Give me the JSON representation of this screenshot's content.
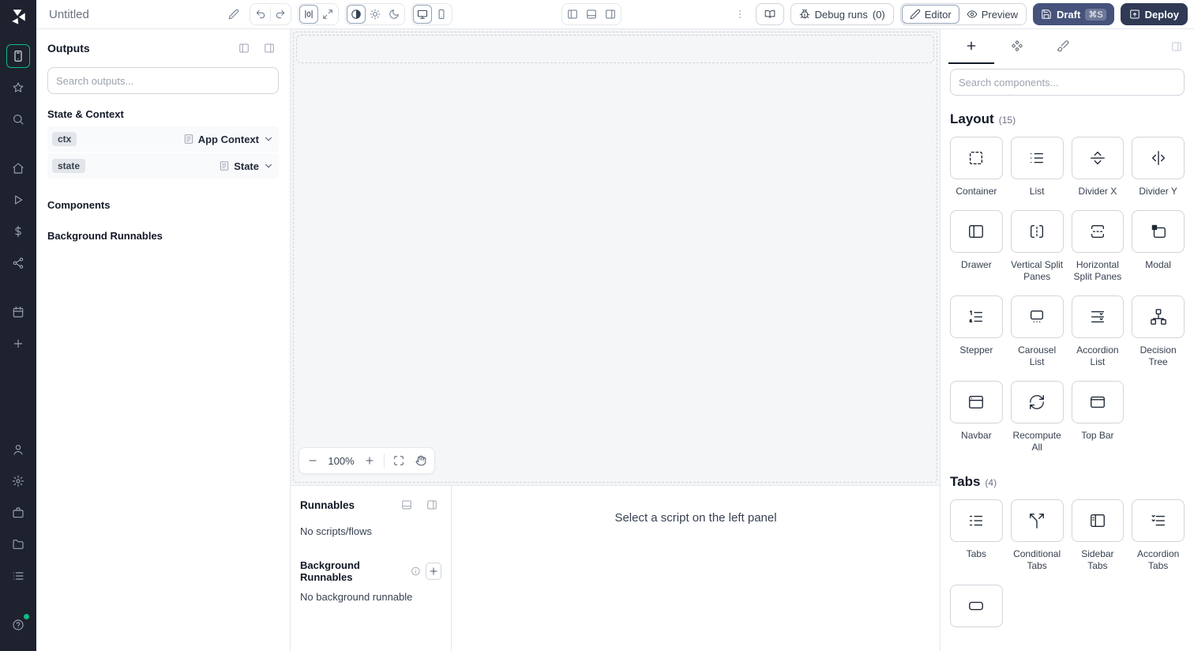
{
  "topbar": {
    "title": "Untitled",
    "debug_runs": {
      "label": "Debug runs",
      "count": "(0)"
    },
    "editor_label": "Editor",
    "preview_label": "Preview",
    "draft_label": "Draft",
    "draft_shortcut": "⌘S",
    "deploy_label": "Deploy",
    "icons": [
      "pencil-icon",
      "undo-icon",
      "redo-icon",
      "guides-icon",
      "expand-icon",
      "contrast-icon",
      "sun-icon",
      "moon-icon",
      "desktop-icon",
      "mobile-icon",
      "panel-left-icon",
      "panel-bottom-icon",
      "panel-right-icon",
      "kebab-icon",
      "book-icon",
      "bug-icon",
      "eye-icon",
      "save-icon",
      "deploy-icon"
    ]
  },
  "outputs": {
    "title": "Outputs",
    "search_placeholder": "Search outputs...",
    "section_state": "State & Context",
    "section_components": "Components",
    "section_background": "Background Runnables",
    "rows": [
      {
        "chip": "ctx",
        "type": "App Context"
      },
      {
        "chip": "state",
        "type": "State"
      }
    ]
  },
  "canvas": {
    "zoom": "100%"
  },
  "runnables": {
    "title": "Runnables",
    "empty": "No scripts/flows",
    "bg_title": "Background Runnables",
    "bg_empty": "No background runnable",
    "select_message": "Select a script on the left panel"
  },
  "components": {
    "search_placeholder": "Search components...",
    "sections": [
      {
        "title": "Layout",
        "count": "(15)",
        "items": [
          {
            "label": "Container",
            "icon": "container-icon"
          },
          {
            "label": "List",
            "icon": "list-icon"
          },
          {
            "label": "Divider X",
            "icon": "divider-x-icon"
          },
          {
            "label": "Divider Y",
            "icon": "divider-y-icon"
          },
          {
            "label": "Drawer",
            "icon": "drawer-icon"
          },
          {
            "label": "Vertical Split Panes",
            "icon": "vertical-split-icon"
          },
          {
            "label": "Horizontal Split Panes",
            "icon": "horizontal-split-icon"
          },
          {
            "label": "Modal",
            "icon": "modal-icon"
          },
          {
            "label": "Stepper",
            "icon": "stepper-icon"
          },
          {
            "label": "Carousel List",
            "icon": "carousel-icon"
          },
          {
            "label": "Accordion List",
            "icon": "accordion-icon"
          },
          {
            "label": "Decision Tree",
            "icon": "decision-tree-icon"
          },
          {
            "label": "Navbar",
            "icon": "navbar-icon"
          },
          {
            "label": "Recompute All",
            "icon": "recompute-icon"
          },
          {
            "label": "Top Bar",
            "icon": "top-bar-icon"
          }
        ]
      },
      {
        "title": "Tabs",
        "count": "(4)",
        "items": [
          {
            "label": "Tabs",
            "icon": "tabs-icon"
          },
          {
            "label": "Conditional Tabs",
            "icon": "conditional-tabs-icon"
          },
          {
            "label": "Sidebar Tabs",
            "icon": "sidebar-tabs-icon"
          },
          {
            "label": "Accordion Tabs",
            "icon": "accordion-tabs-icon"
          }
        ]
      }
    ]
  },
  "colors": {
    "accent_green": "#10b981",
    "rail_bg": "#1d222e",
    "draft_button": "#45527b",
    "deploy_button": "#303a55",
    "border": "#e5e7eb"
  }
}
